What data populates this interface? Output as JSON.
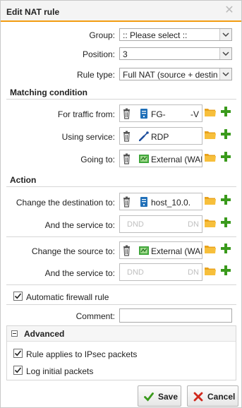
{
  "dialog": {
    "title": "Edit NAT rule",
    "close_icon": "close-icon"
  },
  "fields": {
    "group": {
      "label": "Group:",
      "value": ":: Please select ::"
    },
    "position": {
      "label": "Position:",
      "value": "3"
    },
    "rule_type": {
      "label": "Rule type:",
      "value": "Full NAT (source + destin"
    }
  },
  "matching": {
    "heading": "Matching condition",
    "traffic_from": {
      "label": "For traffic from:",
      "object": "FG-",
      "object_suffix": "-V",
      "icon": "host-icon"
    },
    "using_service": {
      "label": "Using service:",
      "object": "RDP",
      "icon": "service-icon"
    },
    "going_to": {
      "label": "Going to:",
      "object": "External (WAN",
      "icon": "network-icon"
    }
  },
  "action": {
    "heading": "Action",
    "change_destination": {
      "label": "Change the destination to:",
      "object": "host_10.0.",
      "icon": "host-icon"
    },
    "dest_service": {
      "label": "And the service to:",
      "placeholder_left": "DND",
      "placeholder_right": "DN"
    },
    "change_source": {
      "label": "Change the source to:",
      "object": "External (WAN",
      "icon": "network-icon"
    },
    "src_service": {
      "label": "And the service to:",
      "placeholder_left": "DND",
      "placeholder_right": "DN"
    }
  },
  "auto_firewall": {
    "label": "Automatic firewall rule",
    "checked": true
  },
  "comment": {
    "label": "Comment:",
    "value": ""
  },
  "advanced": {
    "heading": "Advanced",
    "ipsec": {
      "label": "Rule applies to IPsec packets",
      "checked": true
    },
    "log_initial": {
      "label": "Log initial packets",
      "checked": true
    }
  },
  "buttons": {
    "save": "Save",
    "cancel": "Cancel"
  },
  "colors": {
    "accent": "#f39c12",
    "plus_green": "#3a9a1c",
    "folder_orange": "#f0a020",
    "cancel_red": "#d0281c"
  }
}
